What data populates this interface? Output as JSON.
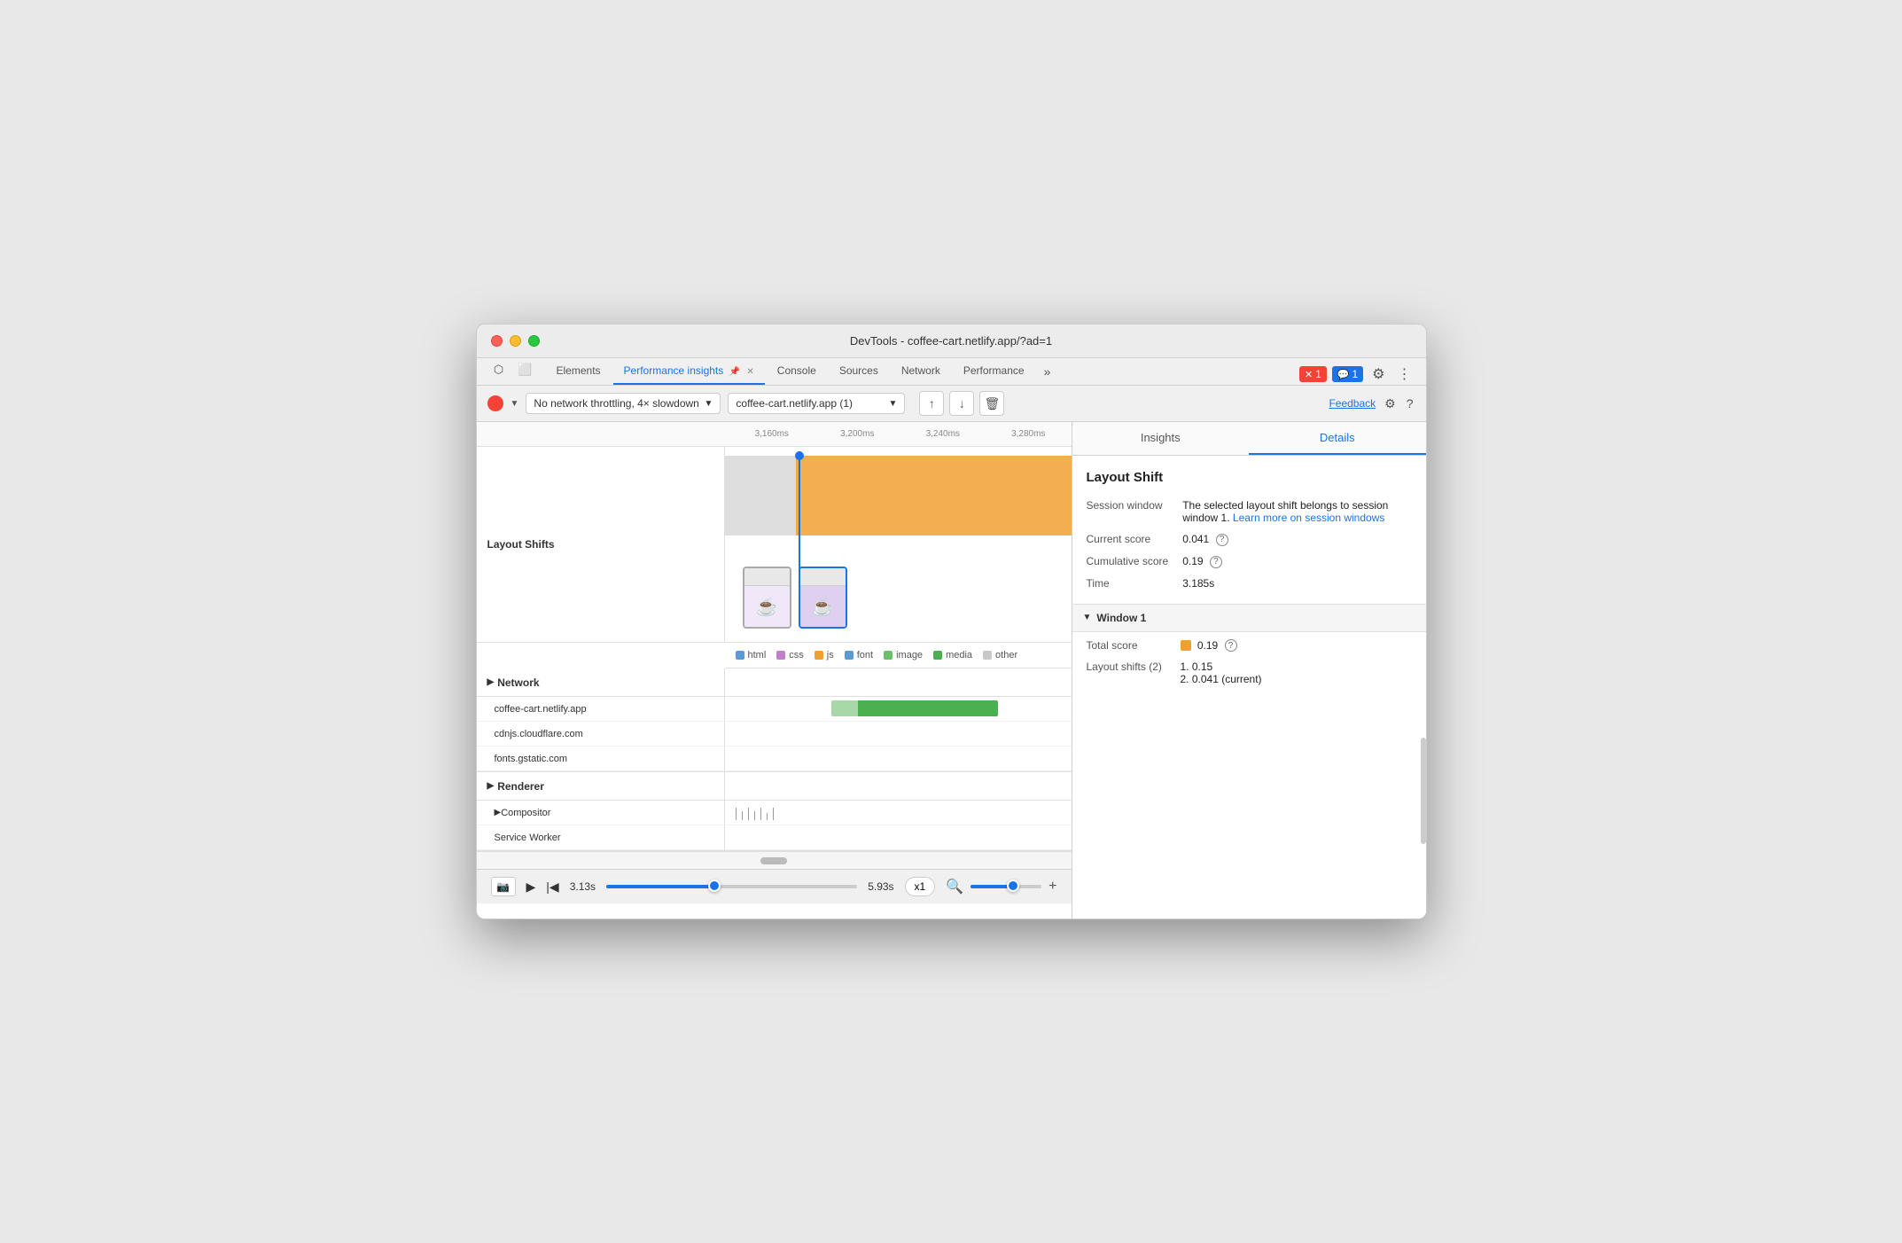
{
  "window": {
    "title": "DevTools - coffee-cart.netlify.app/?ad=1"
  },
  "tabs": {
    "items": [
      {
        "label": "Elements",
        "active": false
      },
      {
        "label": "Performance insights",
        "active": true,
        "pinned": true,
        "closeable": true
      },
      {
        "label": "Console",
        "active": false
      },
      {
        "label": "Sources",
        "active": false
      },
      {
        "label": "Network",
        "active": false
      },
      {
        "label": "Performance",
        "active": false
      }
    ],
    "more_label": "»",
    "error_count": "1",
    "msg_count": "1"
  },
  "toolbar2": {
    "throttle_label": "No network throttling, 4× slowdown",
    "url_label": "coffee-cart.netlify.app (1)",
    "feedback_label": "Feedback",
    "upload_icon": "↑",
    "download_icon": "↓",
    "delete_icon": "🗑"
  },
  "timeline": {
    "time_marks": [
      "3,160ms",
      "3,200ms",
      "3,240ms",
      "3,280ms"
    ],
    "layout_shifts_label": "Layout Shifts",
    "legend": [
      {
        "color": "#5b9bd5",
        "label": "html"
      },
      {
        "color": "#c17ecc",
        "label": "css"
      },
      {
        "color": "#f0a030",
        "label": "js"
      },
      {
        "color": "#5b9bd5",
        "label": "font"
      },
      {
        "color": "#6abf69",
        "label": "image"
      },
      {
        "color": "#4caf50",
        "label": "media"
      },
      {
        "color": "#c8c8c8",
        "label": "other"
      }
    ],
    "network_label": "Network",
    "network_rows": [
      {
        "url": "coffee-cart.netlify.app"
      },
      {
        "url": "cdnjs.cloudflare.com"
      },
      {
        "url": "fonts.gstatic.com"
      }
    ],
    "renderer_label": "Renderer",
    "compositor_label": "Compositor",
    "service_worker_label": "Service Worker"
  },
  "bottom_bar": {
    "time_start": "3.13s",
    "time_end": "5.93s",
    "speed_label": "x1",
    "zoom_out": "−",
    "zoom_in": "+"
  },
  "right_panel": {
    "tabs": [
      {
        "label": "Insights",
        "active": false
      },
      {
        "label": "Details",
        "active": true
      }
    ],
    "section_title": "Layout Shift",
    "session_window_label": "Session window",
    "session_window_text": "The selected layout shift belongs to session window 1.",
    "learn_more_label": "Learn more on",
    "session_windows_link": "session windows",
    "current_score_label": "Current score",
    "current_score_value": "0.041",
    "cumulative_score_label": "Cumulative score",
    "cumulative_score_value": "0.19",
    "time_label": "Time",
    "time_value": "3.185s",
    "window1_label": "Window 1",
    "total_score_label": "Total score",
    "total_score_value": "0.19",
    "layout_shifts_label": "Layout shifts (2)",
    "shift1": "1. 0.15",
    "shift2": "2. 0.041 (current)"
  }
}
